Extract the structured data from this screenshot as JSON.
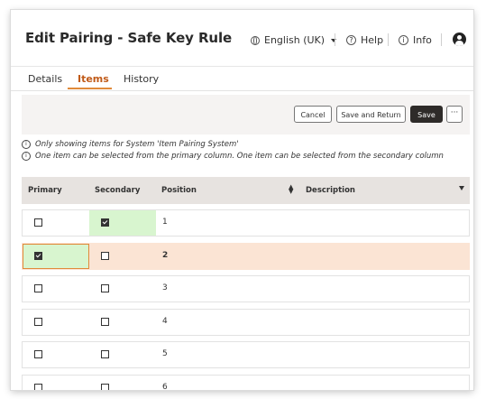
{
  "header": {
    "title": "Edit Pairing - Safe Key Rule",
    "language": "English (UK)",
    "help": "Help",
    "info": "Info"
  },
  "tabs": [
    {
      "label": "Details"
    },
    {
      "label": "Items"
    },
    {
      "label": "History"
    }
  ],
  "active_tab": "Items",
  "toolbar": {
    "cancel": "Cancel",
    "save_return": "Save and Return",
    "save": "Save",
    "more": "···"
  },
  "info": {
    "line1": "Only showing items for System 'Item Pairing System'",
    "line2": "One item can be selected from the primary column. One item can be selected from the secondary column"
  },
  "table": {
    "columns": [
      "Primary",
      "Secondary",
      "Position",
      "Description"
    ],
    "rows": [
      {
        "position": "1",
        "primary": false,
        "secondary": true
      },
      {
        "position": "2",
        "primary": true,
        "secondary": false
      },
      {
        "position": "3",
        "primary": false,
        "secondary": false
      },
      {
        "position": "4",
        "primary": false,
        "secondary": false
      },
      {
        "position": "5",
        "primary": false,
        "secondary": false
      },
      {
        "position": "6",
        "primary": false,
        "secondary": false
      }
    ]
  },
  "colors": {
    "accent": "#e08a3a",
    "selected_row": "#fbe4d4",
    "green_highlight": "#d8f5cf"
  }
}
